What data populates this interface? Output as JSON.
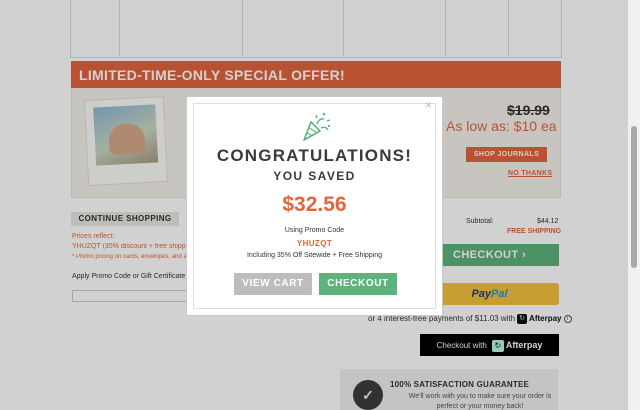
{
  "colors": {
    "accent": "#e1653f",
    "green": "#5fb27c",
    "paypal_yellow": "#f4c13d",
    "dark": "#3a3a3a"
  },
  "offer": {
    "banner": "LIMITED-TIME-ONLY SPECIAL OFFER!",
    "old_price": "$19.99",
    "low_price": "As low as: $10 ea",
    "shop_button": "SHOP JOURNALS",
    "no_thanks": "NO THANKS"
  },
  "cart": {
    "continue_shopping": "CONTINUE SHOPPING",
    "prices_reflect": "Prices reflect:",
    "promo_line": "YHUZQT (35% discount + free shipping",
    "fine_print": "* Promo pricing on cards, envelopes, and a",
    "apply_label": "Apply Promo Code or Gift Certificate",
    "subtotal_label": "Subtotal:",
    "subtotal_value": "$44.12",
    "free_shipping": "FREE SHIPPING",
    "checkout": "CHECKOUT ›",
    "paypal_a": "Pay",
    "paypal_b": "Pal",
    "afterpay_line": "or 4 interest-free payments of $11.03 with",
    "afterpay_brand": "Afterpay",
    "afterpay_button": "Checkout with",
    "afterpay_button_brand": "Afterpay"
  },
  "guarantee": {
    "title": "100% SATISFACTION GUARANTEE",
    "text": "We'll work with you to make sure your order is perfect or your money back!"
  },
  "modal": {
    "close": "×",
    "title": "CONGRATULATIONS!",
    "subtitle": "YOU SAVED",
    "amount": "$32.56",
    "using": "Using Promo Code",
    "code": "YHUZQT",
    "including": "Including 35% Off Sitewide + Free Shipping",
    "view_cart": "VIEW CART",
    "checkout": "CHECKOUT"
  },
  "icons": {
    "party": "party-popper-icon",
    "afterpay": "afterpay-logo-icon",
    "info": "info-icon",
    "guarantee": "guarantee-badge-icon",
    "close": "close-icon"
  }
}
